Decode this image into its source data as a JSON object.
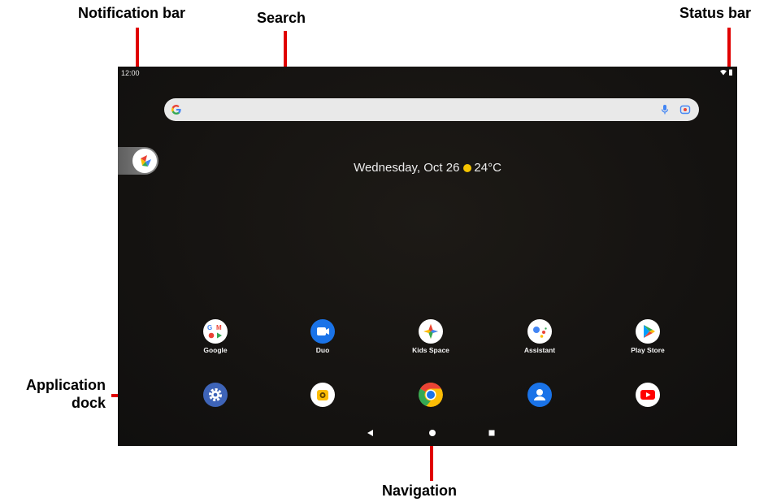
{
  "callouts": {
    "notification_bar": "Notification bar",
    "search": "Search",
    "status_bar": "Status bar",
    "application_dock_line1": "Application",
    "application_dock_line2": "dock",
    "navigation": "Navigation"
  },
  "status": {
    "time": "12:00",
    "icons": [
      "wifi-icon",
      "battery-icon"
    ]
  },
  "search": {
    "icons": [
      "google-g-icon",
      "mic-icon",
      "lens-icon"
    ]
  },
  "widget": {
    "date": "Wednesday, Oct 26",
    "temperature": "24°C",
    "weather_icon": "sun-icon"
  },
  "apps_row": [
    {
      "label": "Google",
      "icon": "google-folder-icon"
    },
    {
      "label": "Duo",
      "icon": "duo-icon"
    },
    {
      "label": "Kids Space",
      "icon": "kids-space-icon"
    },
    {
      "label": "Assistant",
      "icon": "assistant-icon"
    },
    {
      "label": "Play Store",
      "icon": "play-store-icon"
    }
  ],
  "dock": [
    {
      "icon": "settings-icon"
    },
    {
      "icon": "camera-icon"
    },
    {
      "icon": "chrome-icon"
    },
    {
      "icon": "contacts-icon"
    },
    {
      "icon": "youtube-icon"
    }
  ],
  "navigation": [
    "back-icon",
    "home-icon",
    "recents-icon"
  ],
  "colors": {
    "annotation_red": "#e00000",
    "screen_bg": "#151311"
  }
}
